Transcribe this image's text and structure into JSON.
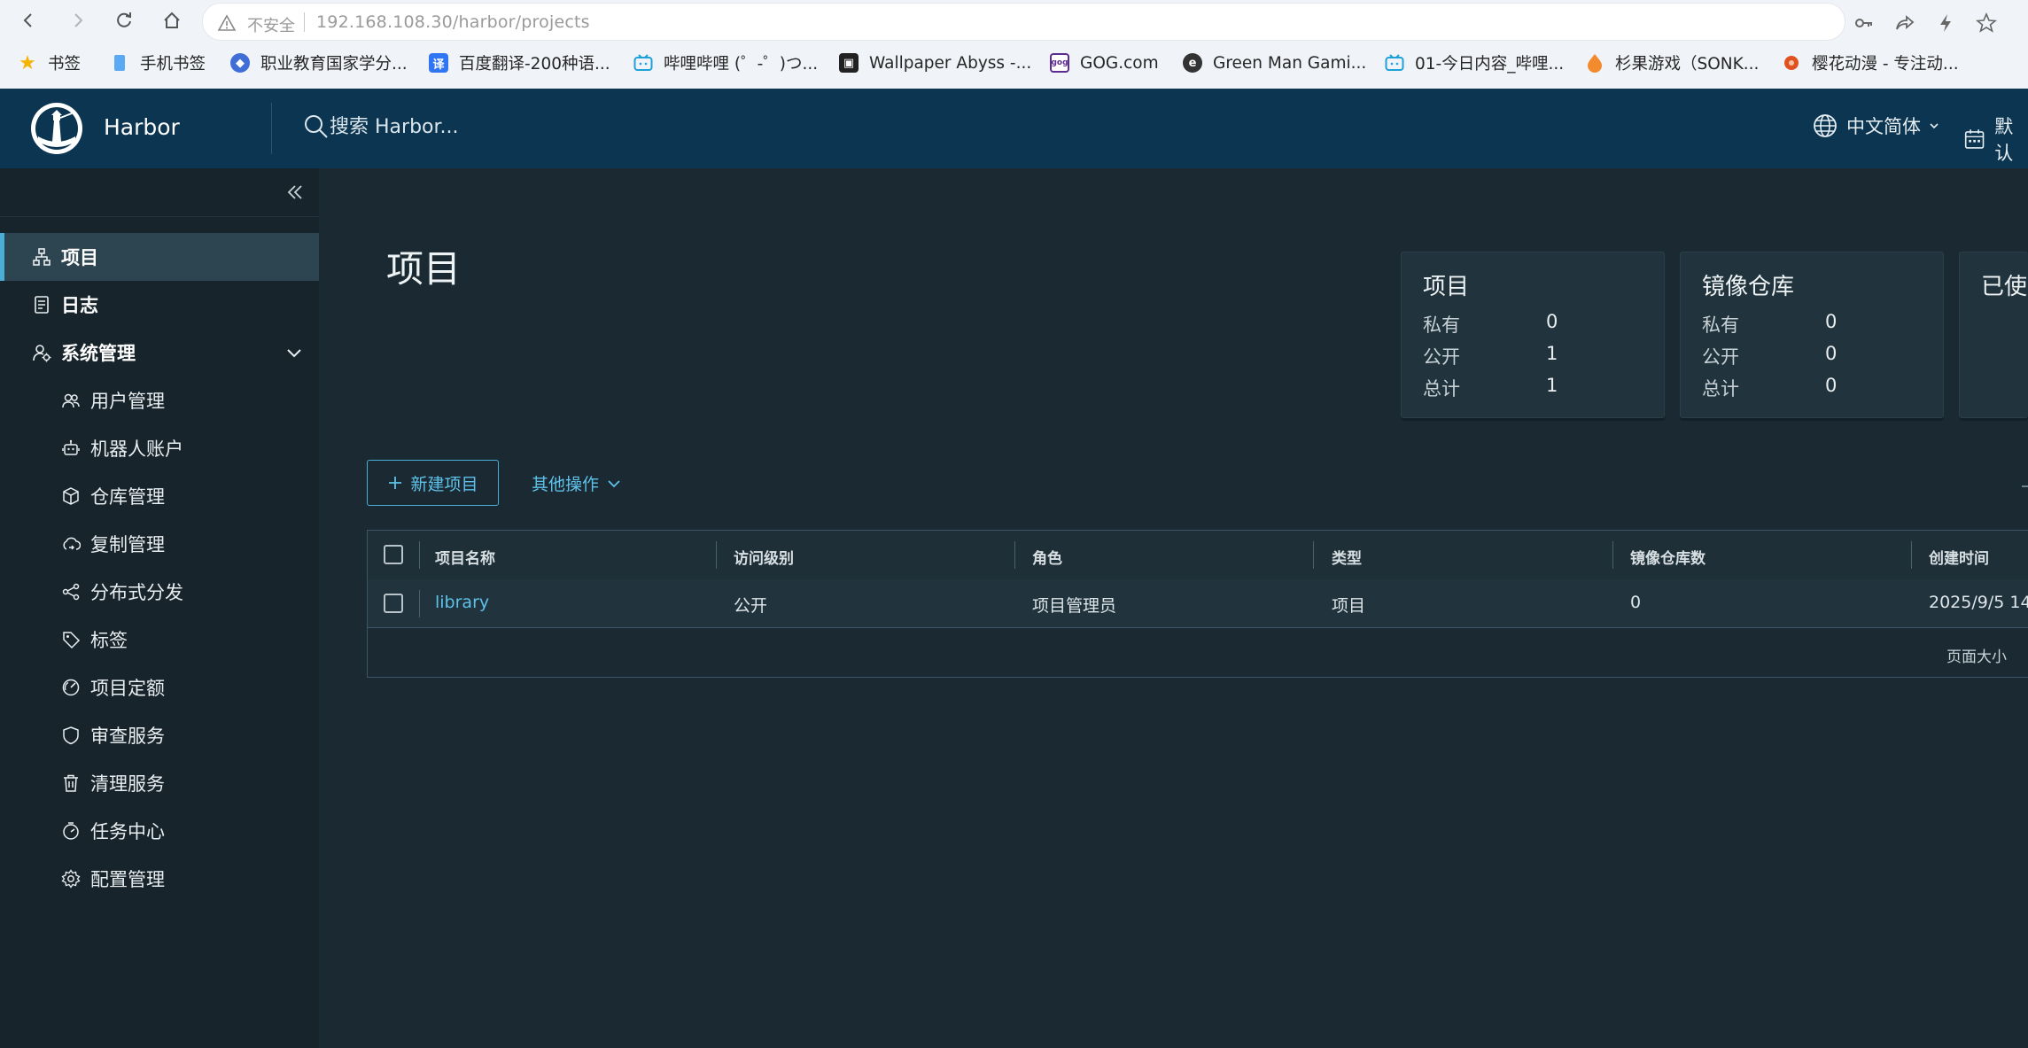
{
  "browser": {
    "url_warning": "不安全",
    "url": "192.168.108.30/harbor/projects",
    "bookmarks": [
      {
        "label": "书签",
        "icon": "star-icon",
        "color": "#f5b400"
      },
      {
        "label": "手机书签",
        "icon": "phone-icon",
        "color": "#5aa9f2"
      },
      {
        "label": "职业教育国家学分...",
        "icon": "site-icon",
        "color": "#3f6ed6"
      },
      {
        "label": "百度翻译-200种语...",
        "icon": "translate-icon",
        "color": "#2f75f4"
      },
      {
        "label": "哔哩哔哩 (゜-゜)つ...",
        "icon": "bilibili-icon",
        "color": "#1da1d6"
      },
      {
        "label": "Wallpaper Abyss -...",
        "icon": "wallpaper-icon",
        "color": "#222222"
      },
      {
        "label": "GOG.com",
        "icon": "gog-icon",
        "color": "#5c2d91"
      },
      {
        "label": "Green Man Gami...",
        "icon": "gmg-icon",
        "color": "#333333"
      },
      {
        "label": "01-今日内容_哔哩...",
        "icon": "bilibili-icon",
        "color": "#1da1d6"
      },
      {
        "label": "杉果游戏（SONK...",
        "icon": "sonkwo-icon",
        "color": "#f28a2e"
      },
      {
        "label": "樱花动漫 - 专注动...",
        "icon": "sakura-icon",
        "color": "#e0531f"
      }
    ]
  },
  "header": {
    "brand": "Harbor",
    "search_placeholder": "搜索 Harbor...",
    "language": "中文简体",
    "date_format": "默认"
  },
  "sidebar": {
    "items": [
      {
        "label": "项目",
        "icon": "projects-icon",
        "active": true
      },
      {
        "label": "日志",
        "icon": "logs-icon"
      },
      {
        "label": "系统管理",
        "icon": "admin-icon",
        "expanded": true
      },
      {
        "label": "用户管理",
        "icon": "users-icon"
      },
      {
        "label": "机器人账户",
        "icon": "robot-icon"
      },
      {
        "label": "仓库管理",
        "icon": "registry-icon"
      },
      {
        "label": "复制管理",
        "icon": "replication-icon"
      },
      {
        "label": "分布式分发",
        "icon": "distribution-icon"
      },
      {
        "label": "标签",
        "icon": "tag-icon"
      },
      {
        "label": "项目定额",
        "icon": "quota-icon"
      },
      {
        "label": "审查服务",
        "icon": "shield-icon"
      },
      {
        "label": "清理服务",
        "icon": "trash-icon"
      },
      {
        "label": "任务中心",
        "icon": "task-icon"
      },
      {
        "label": "配置管理",
        "icon": "settings-icon"
      }
    ]
  },
  "main": {
    "title": "项目",
    "stats": [
      {
        "title": "项目",
        "rows": [
          {
            "label": "私有",
            "value": "0"
          },
          {
            "label": "公开",
            "value": "1"
          },
          {
            "label": "总计",
            "value": "1"
          }
        ]
      },
      {
        "title": "镜像仓库",
        "rows": [
          {
            "label": "私有",
            "value": "0"
          },
          {
            "label": "公开",
            "value": "0"
          },
          {
            "label": "总计",
            "value": "0"
          }
        ]
      },
      {
        "title": "已使",
        "rows": []
      }
    ],
    "new_project": "新建项目",
    "more_actions": "其他操作",
    "table": {
      "columns": [
        "项目名称",
        "访问级别",
        "角色",
        "类型",
        "镜像仓库数",
        "创建时间"
      ],
      "rows": [
        {
          "name": "library",
          "access": "公开",
          "role": "项目管理员",
          "type": "项目",
          "repo_count": "0",
          "created": "2025/9/5 14"
        }
      ],
      "page_size_label": "页面大小"
    }
  },
  "colors": {
    "accent": "#49afd9",
    "link": "#5ec2ea",
    "header_bg": "#0b3550",
    "sidebar_bg": "#17242b",
    "content_bg": "#1b2a32"
  }
}
